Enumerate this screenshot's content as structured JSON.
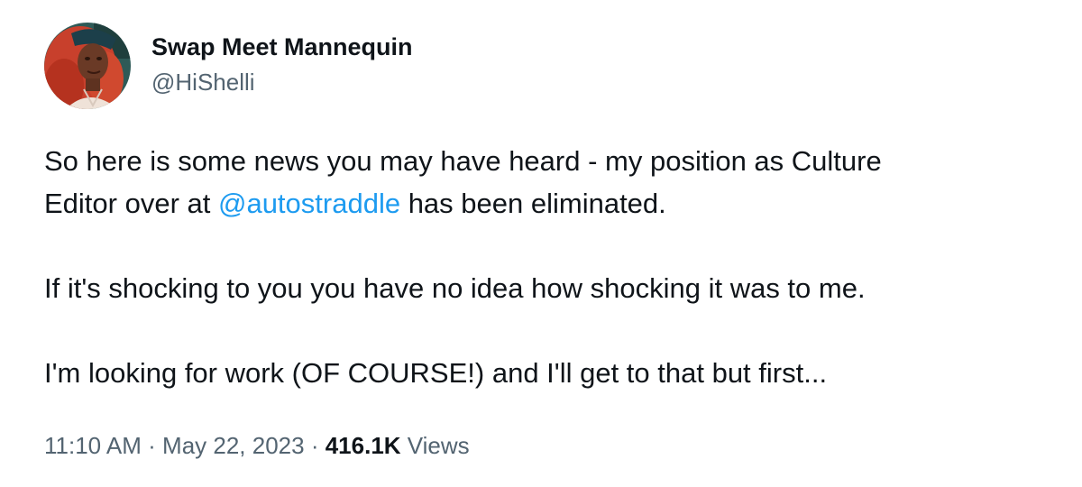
{
  "author": {
    "display_name": "Swap Meet Mannequin",
    "handle": "@HiShelli"
  },
  "tweet": {
    "para1_before": "So here is some news you may have heard - my position as Culture",
    "para1_line2_before": "Editor over at ",
    "mention": "@autostraddle",
    "para1_after": " has been eliminated.",
    "para2": "If it's shocking to you you have no idea how shocking it was to me.",
    "para3": "I'm looking for work (OF COURSE!) and I'll get to that but first..."
  },
  "meta": {
    "time": "11:10 AM",
    "separator": " · ",
    "date": "May 22, 2023",
    "views_count": "416.1K",
    "views_label": " Views"
  },
  "colors": {
    "link": "#1d9bf0",
    "primary_text": "#0f1419",
    "secondary_text": "#536471",
    "avatar_hair": "#c8402c",
    "avatar_skin": "#6a3a26",
    "avatar_bg": "#2e5a57"
  }
}
